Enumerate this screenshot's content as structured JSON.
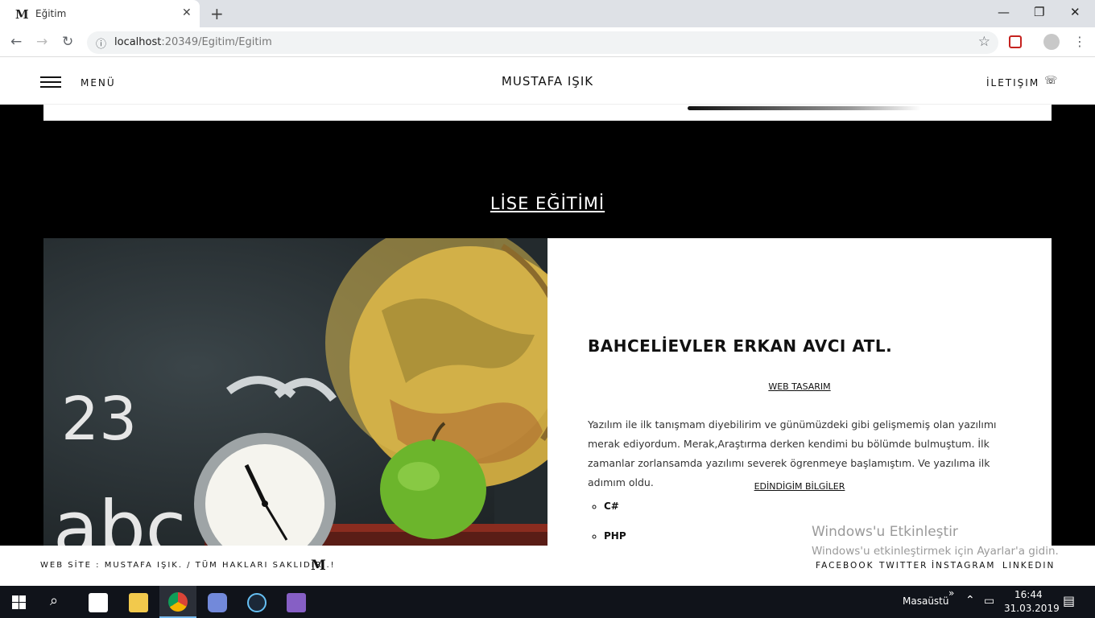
{
  "browser": {
    "tab_title": "Eğitim",
    "tab_favicon": "M",
    "url_host": "localhost",
    "url_rest": ":20349/Egitim/Egitim"
  },
  "site": {
    "menu_label": "MENÜ",
    "brand": "MUSTAFA IŞIK",
    "contact_label": "İLETIŞIM"
  },
  "section": {
    "title": "LİSE EĞİTİMİ",
    "school": "BAHCELİEVLER ERKAN AVCI ATL.",
    "field": "WEB TASARIM",
    "paragraph": "Yazılım ile ilk tanışmam diyebilirim ve günümüzdeki gibi gelişmemiş olan yazılımı merak ediyordum. Merak,Araştırma derken kendimi bu bölümde bulmuştum. İlk zamanlar zorlansamda yazılımı severek ögrenmeye başlamıştım. Ve yazılıma ilk adımım oldu.",
    "learned_title": "EDİNDİGİM BİLGİLER",
    "skills": [
      "C#",
      "PHP"
    ],
    "photo_number": "23",
    "photo_letters": "abc"
  },
  "footer": {
    "copyright": "WEB SİTE : MUSTAFA IŞIK. / TÜM HAKLARI SAKLIDIR..!",
    "logo": "M",
    "social": [
      "FACEBOOK",
      "TWITTER",
      "İNSTAGRAM",
      "LINKEDIN"
    ]
  },
  "watermark": {
    "line1": "Windows'u Etkinleştir",
    "line2": "Windows'u etkinleştirmek için Ayarlar'a gidin."
  },
  "taskbar": {
    "desktop_label": "Masaüstü",
    "time": "16:44",
    "date": "31.03.2019",
    "overflow": "»"
  },
  "colors": {
    "page_bg": "#000000",
    "card_bg": "#ffffff",
    "taskbar_bg": "#10131a"
  },
  "icons": {
    "tab_close": "close-icon",
    "back": "arrow-left-icon",
    "forward": "arrow-right-icon",
    "reload": "reload-icon",
    "bookmark": "star-icon",
    "menu": "hamburger-icon",
    "contact": "phone-icon"
  }
}
